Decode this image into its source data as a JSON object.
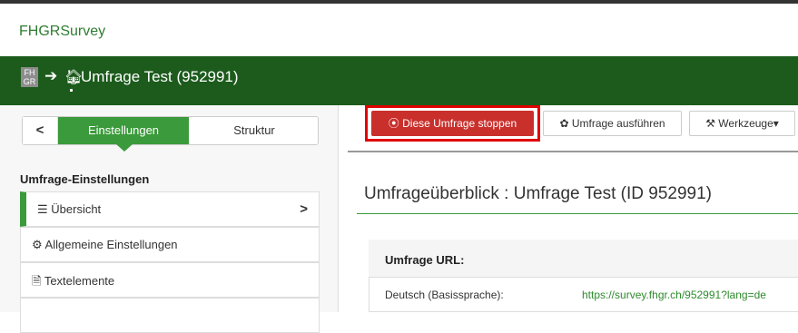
{
  "app": {
    "brand": "FHGRSurvey"
  },
  "breadcrumb": {
    "logo_text": "FH GR",
    "arrow": "➔",
    "home_icon": "home-icon",
    "title": "Umfrage Test (952991)"
  },
  "sidebar": {
    "back_label": "<",
    "tabs": [
      {
        "label": "Einstellungen",
        "active": true
      },
      {
        "label": "Struktur",
        "active": false
      }
    ],
    "heading": "Umfrage-Einstellungen",
    "items": [
      {
        "label": "☰ Übersicht",
        "icon": "list-icon",
        "active": true,
        "chevron": ">"
      },
      {
        "label": "⚙ Allgemeine Einstellungen",
        "icon": "gears-icon"
      },
      {
        "label": "🗎 Textelemente",
        "icon": "document-icon"
      }
    ]
  },
  "toolbar": {
    "stop_label": "⦿ Diese Umfrage stoppen",
    "run_label": "✿ Umfrage ausführen",
    "tools_label": "⚒ Werkzeuge▾"
  },
  "main": {
    "title": "Umfrageüberblick : Umfrage Test (ID 952991)",
    "panel": {
      "heading": "Umfrage URL:",
      "language_label": "Deutsch (Basissprache):",
      "url": "https://survey.fhgr.ch/952991?lang=de"
    }
  },
  "colors": {
    "brand_green": "#2e7d32",
    "bar_green": "#1c5b1c",
    "tab_green": "#3b9a3b",
    "stop_red": "#c9302c",
    "highlight_red": "#e00000"
  }
}
